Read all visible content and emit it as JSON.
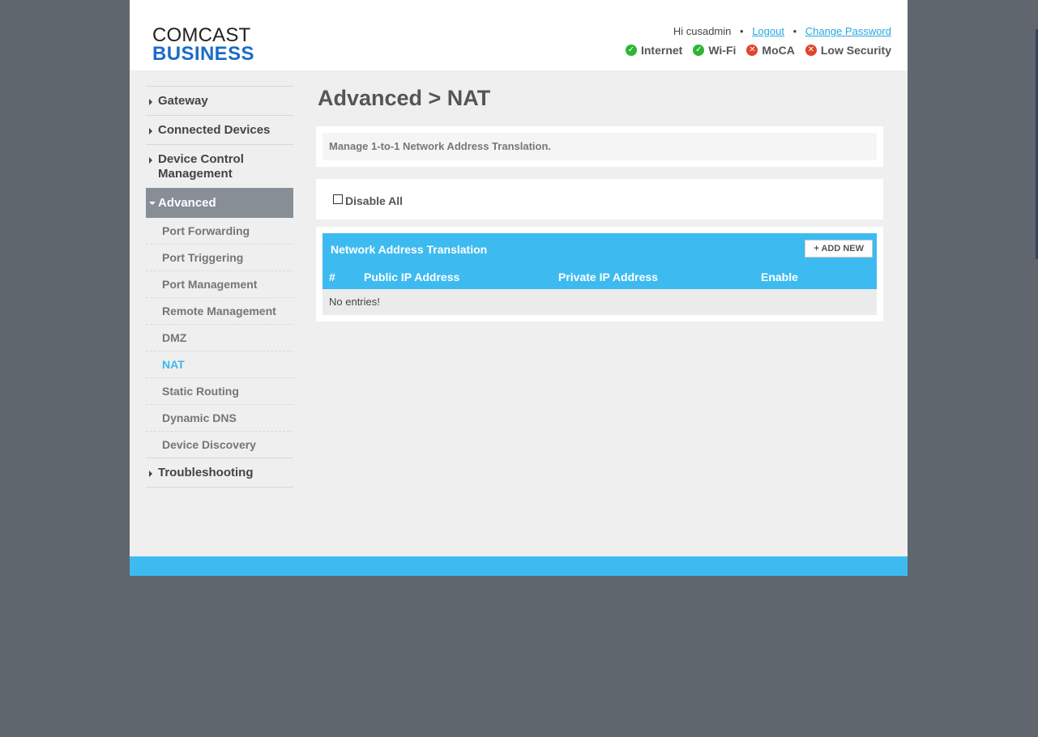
{
  "brand": {
    "line1": "COMCAST",
    "line2": "BUSINESS"
  },
  "user": {
    "greeting": "Hi cusadmin",
    "logout": "Logout",
    "change_password": "Change Password"
  },
  "status": [
    {
      "label": "Internet",
      "state": "ok",
      "icon": "check-circle-icon"
    },
    {
      "label": "Wi-Fi",
      "state": "ok",
      "icon": "check-circle-icon"
    },
    {
      "label": "MoCA",
      "state": "error",
      "icon": "x-circle-icon"
    },
    {
      "label": "Low Security",
      "state": "error",
      "icon": "x-circle-icon"
    }
  ],
  "nav": {
    "gateway": "Gateway",
    "connected_devices": "Connected Devices",
    "device_control": "Device Control Management",
    "advanced": "Advanced",
    "advanced_items": [
      "Port Forwarding",
      "Port Triggering",
      "Port Management",
      "Remote Management",
      "DMZ",
      "NAT",
      "Static Routing",
      "Dynamic DNS",
      "Device Discovery"
    ],
    "current": "NAT",
    "troubleshooting": "Troubleshooting"
  },
  "page": {
    "title": "Advanced > NAT",
    "description": "Manage 1-to-1 Network Address Translation.",
    "disable_all_label": "Disable All",
    "disable_all_checked": false
  },
  "table": {
    "title": "Network Address Translation",
    "add_button": "+ ADD NEW",
    "columns": [
      "#",
      "Public IP Address",
      "Private IP Address",
      "Enable"
    ],
    "empty_text": "No entries!"
  },
  "colors": {
    "accent": "#3dbbf0",
    "ok": "#2fb534",
    "error": "#e0442c",
    "brand_blue": "#1b6cc6"
  }
}
